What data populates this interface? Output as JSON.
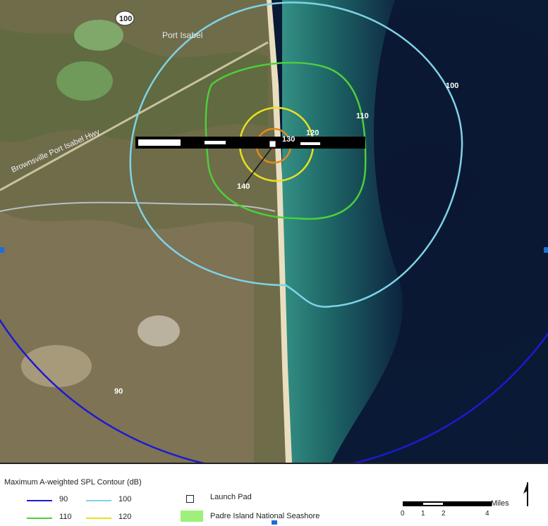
{
  "map": {
    "place_labels": {
      "port_isabel": "Port Isabel",
      "highway": "Brownsville Port Isabel Hwy",
      "route_shield": "100"
    },
    "contour_labels": {
      "c90": "90",
      "c100": "100",
      "c110": "110",
      "c120": "120",
      "c130": "130",
      "c140": "140"
    },
    "colors": {
      "contour_90": "#1b1bd0",
      "contour_100": "#7fd3e6",
      "contour_110": "#4ccf3a",
      "contour_120": "#e8e020",
      "contour_130": "#e08a1a",
      "contour_140": "#d23a1a",
      "water_deep": "#0a1a36",
      "water_shallow": "#2f8a82",
      "land": "#6b6a48",
      "park": "#9ef07a"
    }
  },
  "legend": {
    "title": "Maximum A-weighted SPL Contour (dB)",
    "items": [
      {
        "label": "90",
        "color": "#1b1bd0"
      },
      {
        "label": "100",
        "color": "#7fd3e6"
      },
      {
        "label": "110",
        "color": "#4ccf3a"
      },
      {
        "label": "120",
        "color": "#e8e020"
      }
    ],
    "launch_pad": "Launch Pad",
    "park": "Padre Island National Seashore",
    "scale": {
      "unit": "Miles",
      "ticks": [
        "0",
        "1",
        "2",
        "4"
      ]
    }
  }
}
